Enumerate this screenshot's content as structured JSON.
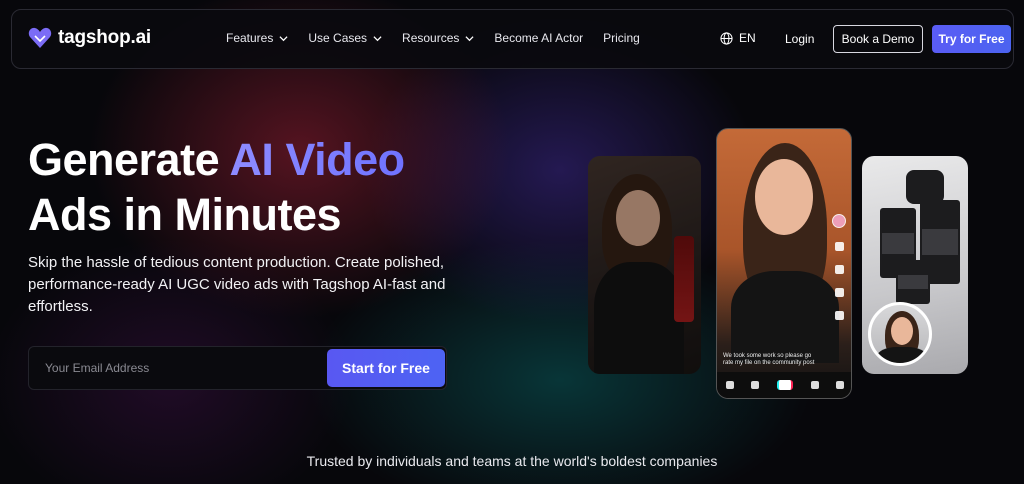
{
  "nav": {
    "logo_text": "tagshop.ai",
    "menu": [
      {
        "label": "Features",
        "has_dropdown": true
      },
      {
        "label": "Use Cases",
        "has_dropdown": true
      },
      {
        "label": "Resources",
        "has_dropdown": true
      },
      {
        "label": "Become AI Actor",
        "has_dropdown": false
      },
      {
        "label": "Pricing",
        "has_dropdown": false
      }
    ],
    "language": "EN",
    "login": "Login",
    "book_demo": "Book a Demo",
    "try_free": "Try for Free"
  },
  "hero": {
    "headline_part1": "Generate ",
    "headline_accent": "AI Video",
    "headline_line2": "Ads in Minutes",
    "subtitle": "Skip the hassle of tedious content production. Create polished, performance-ready AI UGC video ads with Tagshop AI-fast and effortless.",
    "email_placeholder": "Your Email Address",
    "cta": "Start for Free"
  },
  "preview": {
    "caption": "We took some work so please go rate my file on the community post"
  },
  "trusted_text": "Trusted by individuals and teams at the world's boldest companies",
  "colors": {
    "accent": "#5b5cf5",
    "accent_text": "#8e8cff",
    "background": "#07070b"
  }
}
